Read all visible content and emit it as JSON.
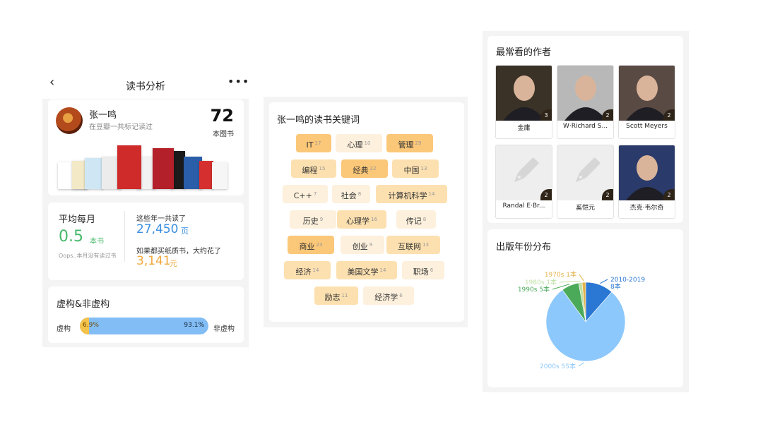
{
  "panel1": {
    "nav_title": "读书分析",
    "back_glyph": "‹",
    "more_glyph": "•••",
    "profile": {
      "name": "张一鸣",
      "subtitle": "在豆瓣一共标记读过",
      "count": "72",
      "count_unit": "本图书"
    },
    "book_covers": [
      {
        "color": "#ffffff"
      },
      {
        "color": "#f3e9c7"
      },
      {
        "color": "#cfe7f5"
      },
      {
        "color": "#ececec"
      },
      {
        "color": "#cf2b2b"
      },
      {
        "color": "#f2f2f2"
      },
      {
        "color": "#b3202a"
      },
      {
        "color": "#1b1b1b"
      },
      {
        "color": "#2b5ea8"
      },
      {
        "color": "#d62f2f"
      },
      {
        "color": "#f6f6f6"
      }
    ],
    "stats": {
      "title": "平均每月",
      "avg": "0.5",
      "avg_unit": "本书",
      "note": "Oops..本月没有读过书",
      "pages_label": "这些年一共读了",
      "pages": "27,450",
      "pages_unit": "页",
      "cost_label": "如果都买纸质书，大约花了",
      "cost": "3,141",
      "cost_unit": "元"
    },
    "fiction": {
      "title": "虚构&非虚构",
      "left_label": "虚构",
      "right_label": "非虚构",
      "fiction_pct_text": "6.9%",
      "nonfiction_pct_text": "93.1%",
      "fiction_share": 0.069
    }
  },
  "panel2": {
    "title": "张一鸣的读书关键词",
    "keywords": [
      {
        "word": "IT",
        "count": "17",
        "level": "high"
      },
      {
        "word": "心理",
        "count": "10",
        "level": "low"
      },
      {
        "word": "管理",
        "count": "29",
        "level": "high"
      },
      {
        "word": "编程",
        "count": "15",
        "level": "mid"
      },
      {
        "word": "经典",
        "count": "22",
        "level": "high"
      },
      {
        "word": "中国",
        "count": "13",
        "level": "mid"
      },
      {
        "word": "C++",
        "count": "7",
        "level": "low"
      },
      {
        "word": "社会",
        "count": "8",
        "level": "low"
      },
      {
        "word": "计算机科学",
        "count": "14",
        "level": "mid"
      },
      {
        "word": "历史",
        "count": "9",
        "level": "low"
      },
      {
        "word": "心理学",
        "count": "16",
        "level": "mid"
      },
      {
        "word": "传记",
        "count": "8",
        "level": "low"
      },
      {
        "word": "商业",
        "count": "23",
        "level": "high"
      },
      {
        "word": "创业",
        "count": "9",
        "level": "low"
      },
      {
        "word": "互联网",
        "count": "13",
        "level": "mid"
      },
      {
        "word": "经济",
        "count": "14",
        "level": "mid"
      },
      {
        "word": "美国文学",
        "count": "14",
        "level": "mid"
      },
      {
        "word": "职场",
        "count": "6",
        "level": "low"
      },
      {
        "word": "励志",
        "count": "11",
        "level": "mid"
      },
      {
        "word": "经济学",
        "count": "6",
        "level": "low"
      }
    ],
    "level_colors": {
      "high": "#fbc778",
      "mid": "#fde0b0",
      "low": "#fdf0dc"
    }
  },
  "panel3": {
    "authors_title": "最常看的作者",
    "authors": [
      {
        "name": "金庸",
        "count": "3",
        "photo": "photo"
      },
      {
        "name": "W·Richard S...",
        "count": "2",
        "photo": "photo"
      },
      {
        "name": "Scott Meyers",
        "count": "2",
        "photo": "photo"
      },
      {
        "name": "Randal E·Br...",
        "count": "2",
        "photo": "pen-placeholder-icon"
      },
      {
        "name": "奚恺元",
        "count": "2",
        "photo": "pen-placeholder-icon"
      },
      {
        "name": "杰克·韦尔奇",
        "count": "2",
        "photo": "photo"
      }
    ],
    "years_title": "出版年份分布"
  },
  "chart_data": {
    "type": "pie",
    "title": "出版年份分布",
    "slices": [
      {
        "label": "2010-2019",
        "count_label": "8本",
        "value": 8,
        "color": "#2a77d4"
      },
      {
        "label": "2000s",
        "count_label": "55本",
        "value": 55,
        "color": "#8cc8fb"
      },
      {
        "label": "1990s",
        "count_label": "5本",
        "value": 5,
        "color": "#4aaa59"
      },
      {
        "label": "1980s",
        "count_label": "1本",
        "value": 1,
        "color": "#bfe0a6"
      },
      {
        "label": "1970s",
        "count_label": "1本",
        "value": 1,
        "color": "#e2b34a"
      }
    ]
  }
}
